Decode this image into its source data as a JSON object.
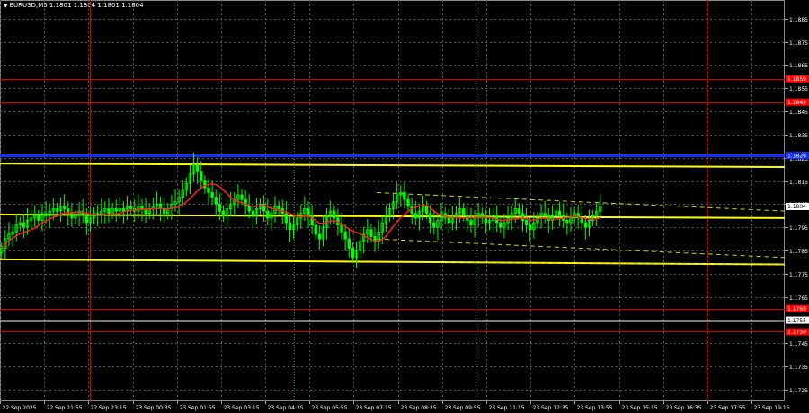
{
  "window": {
    "title": "EURUSD,M5  1.1801 1.1804 1.1801 1.1804"
  },
  "colors": {
    "background": "#000000",
    "grid": "#5a5a5a",
    "candle": "#00ff00",
    "ma": "#ff2020",
    "level_red": "#d40000",
    "level_yellow": "#ffff00",
    "level_blue": "#1030ff",
    "level_white": "#e8e8e8",
    "price_label_bg": "#ffffff",
    "red_label_bg": "#ff0000",
    "blue_label_bg": "#1030ff",
    "axis_text": "#ffffff"
  },
  "icons": {
    "title_marker": "triangle-down-icon"
  },
  "chart_data": {
    "type": "candlestick",
    "symbol": "EURUSD",
    "timeframe": "M5",
    "ohlc_header": [
      1.1801,
      1.1804,
      1.1801,
      1.1804
    ],
    "ylim": [
      1.172,
      1.1893
    ],
    "y_ticks": [
      "1.1885",
      "1.1875",
      "1.1865",
      "1.1855",
      "1.1845",
      "1.1835",
      "1.1825",
      "1.1815",
      "1.1805",
      "1.1795",
      "1.1785",
      "1.1775",
      "1.1765",
      "1.1755",
      "1.1745",
      "1.1735",
      "1.1725"
    ],
    "x_ticks": [
      "22 Sep 2025",
      "22 Sep 21:55",
      "22 Sep 23:15",
      "23 Sep 00:35",
      "23 Sep 01:55",
      "23 Sep 03:15",
      "23 Sep 04:35",
      "23 Sep 05:55",
      "23 Sep 07:15",
      "23 Sep 08:35",
      "23 Sep 09:55",
      "23 Sep 11:15",
      "23 Sep 12:35",
      "23 Sep 13:55",
      "23 Sep 15:15",
      "23 Sep 16:35",
      "23 Sep 17:55",
      "23 Sep 19:15"
    ],
    "current_price": "1.1804",
    "price_labels": [
      {
        "text": "1.1859",
        "value": 1.1859,
        "kind": "red"
      },
      {
        "text": "1.1849",
        "value": 1.1849,
        "kind": "red"
      },
      {
        "text": "1.1826",
        "value": 1.1826,
        "kind": "blue"
      },
      {
        "text": "1.1760",
        "value": 1.176,
        "kind": "red"
      },
      {
        "text": "1.1750",
        "value": 1.175,
        "kind": "red"
      },
      {
        "text": "1.1755",
        "value": 1.1755,
        "kind": "white"
      }
    ],
    "horizontal_levels": [
      {
        "value": 1.1859,
        "color": "red"
      },
      {
        "value": 1.1849,
        "color": "red"
      },
      {
        "value": 1.1826,
        "color": "blue"
      },
      {
        "value": 1.176,
        "color": "red"
      },
      {
        "value": 1.175,
        "color": "red"
      },
      {
        "value": 1.1755,
        "color": "white"
      }
    ],
    "yellow_lines": [
      {
        "from": [
          0,
          1.18225
        ],
        "to": [
          1,
          1.1821
        ]
      },
      {
        "from": [
          0,
          1.18005
        ],
        "to": [
          1,
          1.1799
        ]
      },
      {
        "from": [
          0,
          1.17812
        ],
        "to": [
          1,
          1.1779
        ]
      }
    ],
    "channel_lines": [
      {
        "from": [
          0.48,
          1.181
        ],
        "to": [
          1,
          1.1802
        ]
      },
      {
        "from": [
          0.48,
          1.179
        ],
        "to": [
          1,
          1.1782
        ]
      },
      {
        "from": [
          0.57,
          1.178
        ],
        "to": [
          1,
          1.1779
        ]
      }
    ],
    "session_verticals_red": [
      0.115,
      0.9
    ],
    "session_verticals_green": [
      0.374,
      0.606
    ],
    "series_close": [
      1.1786,
      1.179,
      1.1792,
      1.1793,
      1.1796,
      1.1797,
      1.1795,
      1.1798,
      1.1799,
      1.18,
      1.1798,
      1.1801,
      1.18,
      1.1802,
      1.1803,
      1.1802,
      1.1804,
      1.1803,
      1.1801,
      1.1799,
      1.18,
      1.1802,
      1.18,
      1.1797,
      1.1799,
      1.1801,
      1.18,
      1.1802,
      1.1803,
      1.1801,
      1.1803,
      1.1802,
      1.1803,
      1.1802,
      1.1804,
      1.1803,
      1.1802,
      1.1804,
      1.1803,
      1.1801,
      1.1803,
      1.1804,
      1.1805,
      1.1803,
      1.1801,
      1.1803,
      1.1805,
      1.1806,
      1.1808,
      1.1811,
      1.1814,
      1.1818,
      1.1822,
      1.1819,
      1.1815,
      1.1812,
      1.181,
      1.1808,
      1.1805,
      1.1802,
      1.18,
      1.1803,
      1.1805,
      1.1807,
      1.1809,
      1.1807,
      1.1804,
      1.1802,
      1.18,
      1.1803,
      1.1805,
      1.1802,
      1.1799,
      1.1801,
      1.1804,
      1.1803,
      1.1801,
      1.1797,
      1.1794,
      1.1796,
      1.1799,
      1.1801,
      1.1803,
      1.18,
      1.1796,
      1.1792,
      1.179,
      1.1795,
      1.18,
      1.1802,
      1.1799,
      1.1796,
      1.1793,
      1.179,
      1.1786,
      1.1782,
      1.1785,
      1.1789,
      1.1792,
      1.1794,
      1.1791,
      1.1789,
      1.1793,
      1.1797,
      1.18,
      1.1803,
      1.1806,
      1.1809,
      1.181,
      1.1807,
      1.1804,
      1.1801,
      1.1799,
      1.1802,
      1.1804,
      1.1801,
      1.1797,
      1.1795,
      1.1798,
      1.1801,
      1.1799,
      1.1797,
      1.1799,
      1.1801,
      1.1803,
      1.18,
      1.1798,
      1.1796,
      1.1799,
      1.1801,
      1.1799,
      1.1797,
      1.1798,
      1.18,
      1.1797,
      1.1795,
      1.1797,
      1.1799,
      1.1801,
      1.1803,
      1.1801,
      1.1798,
      1.1796,
      1.1794,
      1.1797,
      1.1799,
      1.1801,
      1.18,
      1.1798,
      1.18,
      1.1802,
      1.18,
      1.1798,
      1.1797,
      1.1799,
      1.1801,
      1.1799,
      1.1797,
      1.1795,
      1.1798,
      1.18,
      1.1802,
      1.1804
    ]
  }
}
